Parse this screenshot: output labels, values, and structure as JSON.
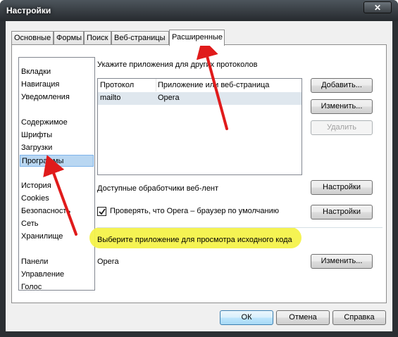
{
  "window": {
    "title": "Настройки",
    "close_glyph": "✕"
  },
  "tabs": [
    {
      "label": "Основные"
    },
    {
      "label": "Формы"
    },
    {
      "label": "Поиск"
    },
    {
      "label": "Веб-страницы"
    },
    {
      "label": "Расширенные",
      "active": true
    }
  ],
  "nav": {
    "items": [
      {
        "label": "Вкладки"
      },
      {
        "label": "Навигация"
      },
      {
        "label": "Уведомления"
      },
      {
        "label": "Содержимое"
      },
      {
        "label": "Шрифты"
      },
      {
        "label": "Загрузки"
      },
      {
        "label": "Программы",
        "selected": true
      },
      {
        "label": "История"
      },
      {
        "label": "Cookies"
      },
      {
        "label": "Безопасность"
      },
      {
        "label": "Сеть"
      },
      {
        "label": "Хранилище"
      },
      {
        "label": "Панели"
      },
      {
        "label": "Управление"
      },
      {
        "label": "Голос"
      }
    ]
  },
  "protocols": {
    "heading": "Укажите приложения для других протоколов",
    "columns": [
      "Протокол",
      "Приложение или веб-страница"
    ],
    "rows": [
      [
        "mailto",
        "Opera"
      ]
    ],
    "add_button": "Добавить...",
    "change_button": "Изменить...",
    "delete_button": "Удалить"
  },
  "feeds": {
    "label": "Доступные обработчики веб-лент",
    "button": "Настройки"
  },
  "default_browser": {
    "checkbox_label": "Проверять, что Opera – браузер по умолчанию",
    "checked": true,
    "button": "Настройки"
  },
  "source_viewer": {
    "label": "Выберите приложение для просмотра исходного кода",
    "app": "Opera",
    "button": "Изменить..."
  },
  "footer": {
    "ok": "ОК",
    "cancel": "Отмена",
    "help": "Справка"
  },
  "colors": {
    "annotation_arrow": "#e01b1b",
    "highlight": "#f4f24a",
    "selection": "#b9d7f2"
  }
}
